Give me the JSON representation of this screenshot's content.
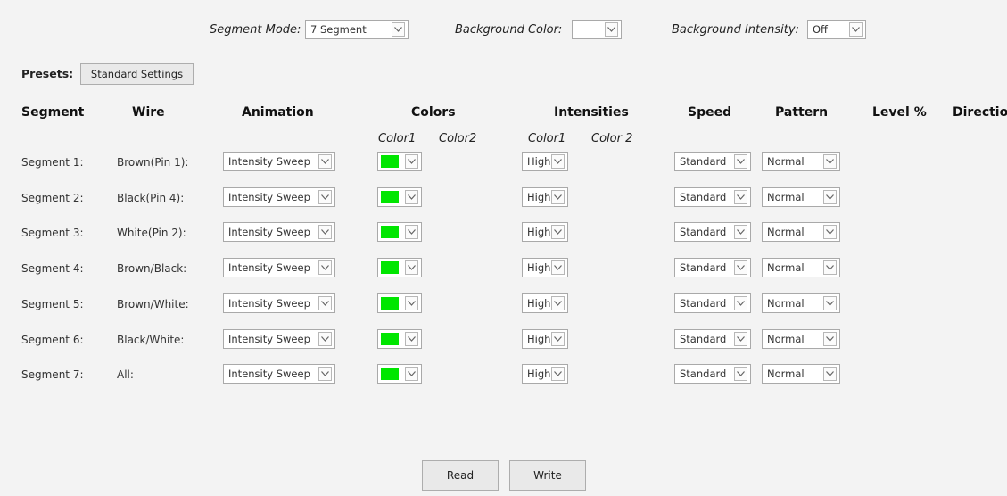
{
  "top": {
    "segment_mode_label": "Segment Mode:",
    "segment_mode_value": "7 Segment",
    "background_color_label": "Background  Color:",
    "background_color_value": "",
    "background_intensity_label": "Background  Intensity:",
    "background_intensity_value": "Off"
  },
  "presets": {
    "label": "Presets:",
    "button": "Standard Settings"
  },
  "headers": {
    "segment": "Segment",
    "wire": "Wire",
    "animation": "Animation",
    "colors": "Colors",
    "intensities": "Intensities",
    "speed": "Speed",
    "pattern": "Pattern",
    "level": "Level %",
    "direction": "Direction"
  },
  "subheaders": {
    "color1": "Color1",
    "color2": "Color2",
    "int1": "Color1",
    "int2": "Color 2"
  },
  "rows": [
    {
      "segment": "Segment 1:",
      "wire": "Brown(Pin 1):",
      "animation": "Intensity Sweep",
      "color1": "#00e600",
      "intensity1": "High",
      "speed": "Standard",
      "pattern": "Normal"
    },
    {
      "segment": "Segment 2:",
      "wire": "Black(Pin 4):",
      "animation": "Intensity Sweep",
      "color1": "#00e600",
      "intensity1": "High",
      "speed": "Standard",
      "pattern": "Normal"
    },
    {
      "segment": "Segment 3:",
      "wire": "White(Pin 2):",
      "animation": "Intensity Sweep",
      "color1": "#00e600",
      "intensity1": "High",
      "speed": "Standard",
      "pattern": "Normal"
    },
    {
      "segment": "Segment 4:",
      "wire": "Brown/Black:",
      "animation": "Intensity Sweep",
      "color1": "#00e600",
      "intensity1": "High",
      "speed": "Standard",
      "pattern": "Normal"
    },
    {
      "segment": "Segment 5:",
      "wire": "Brown/White:",
      "animation": "Intensity Sweep",
      "color1": "#00e600",
      "intensity1": "High",
      "speed": "Standard",
      "pattern": "Normal"
    },
    {
      "segment": "Segment 6:",
      "wire": "Black/White:",
      "animation": "Intensity Sweep",
      "color1": "#00e600",
      "intensity1": "High",
      "speed": "Standard",
      "pattern": "Normal"
    },
    {
      "segment": "Segment 7:",
      "wire": "All:",
      "animation": "Intensity Sweep",
      "color1": "#00e600",
      "intensity1": "High",
      "speed": "Standard",
      "pattern": "Normal"
    }
  ],
  "buttons": {
    "read": "Read",
    "write": "Write"
  },
  "icons": {
    "dropdown": "chevron-down-icon"
  }
}
